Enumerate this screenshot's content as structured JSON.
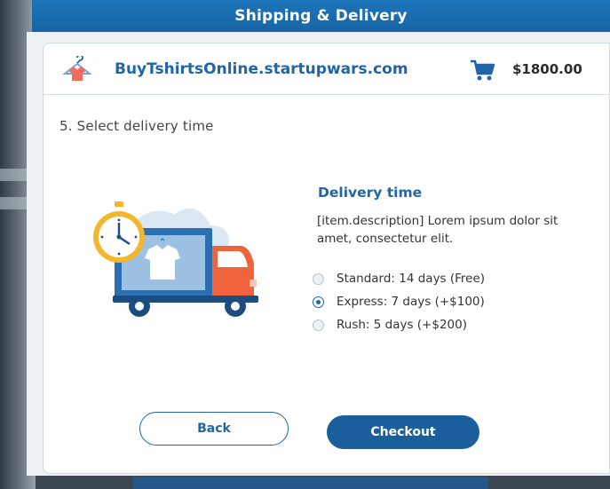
{
  "window": {
    "title": "Shipping & Delivery"
  },
  "store": {
    "name": "BuyTshirtsOnline.startupwars.com",
    "logo_icon": "tshirt-hanger-icon",
    "cart_icon": "shopping-cart-icon",
    "cart_total": "$1800.00"
  },
  "step": {
    "title": "5. Select delivery time"
  },
  "illustration": {
    "icon": "delivery-truck-clock-icon"
  },
  "delivery": {
    "heading": "Delivery time",
    "description": "[item.description] Lorem ipsum dolor sit amet, consectetur elit.",
    "options": [
      {
        "label": "Standard: 14 days (Free)",
        "selected": false
      },
      {
        "label": "Express: 7 days (+$100)",
        "selected": true
      },
      {
        "label": "Rush: 5 days (+$200)",
        "selected": false
      }
    ]
  },
  "buttons": {
    "back": "Back",
    "checkout": "Checkout"
  },
  "colors": {
    "titlebar": "#1d74b9",
    "accent": "#1f65a8",
    "checkout_bg": "#1a5f9c",
    "truck_cab": "#f0633d",
    "clock": "#f3b72c"
  }
}
